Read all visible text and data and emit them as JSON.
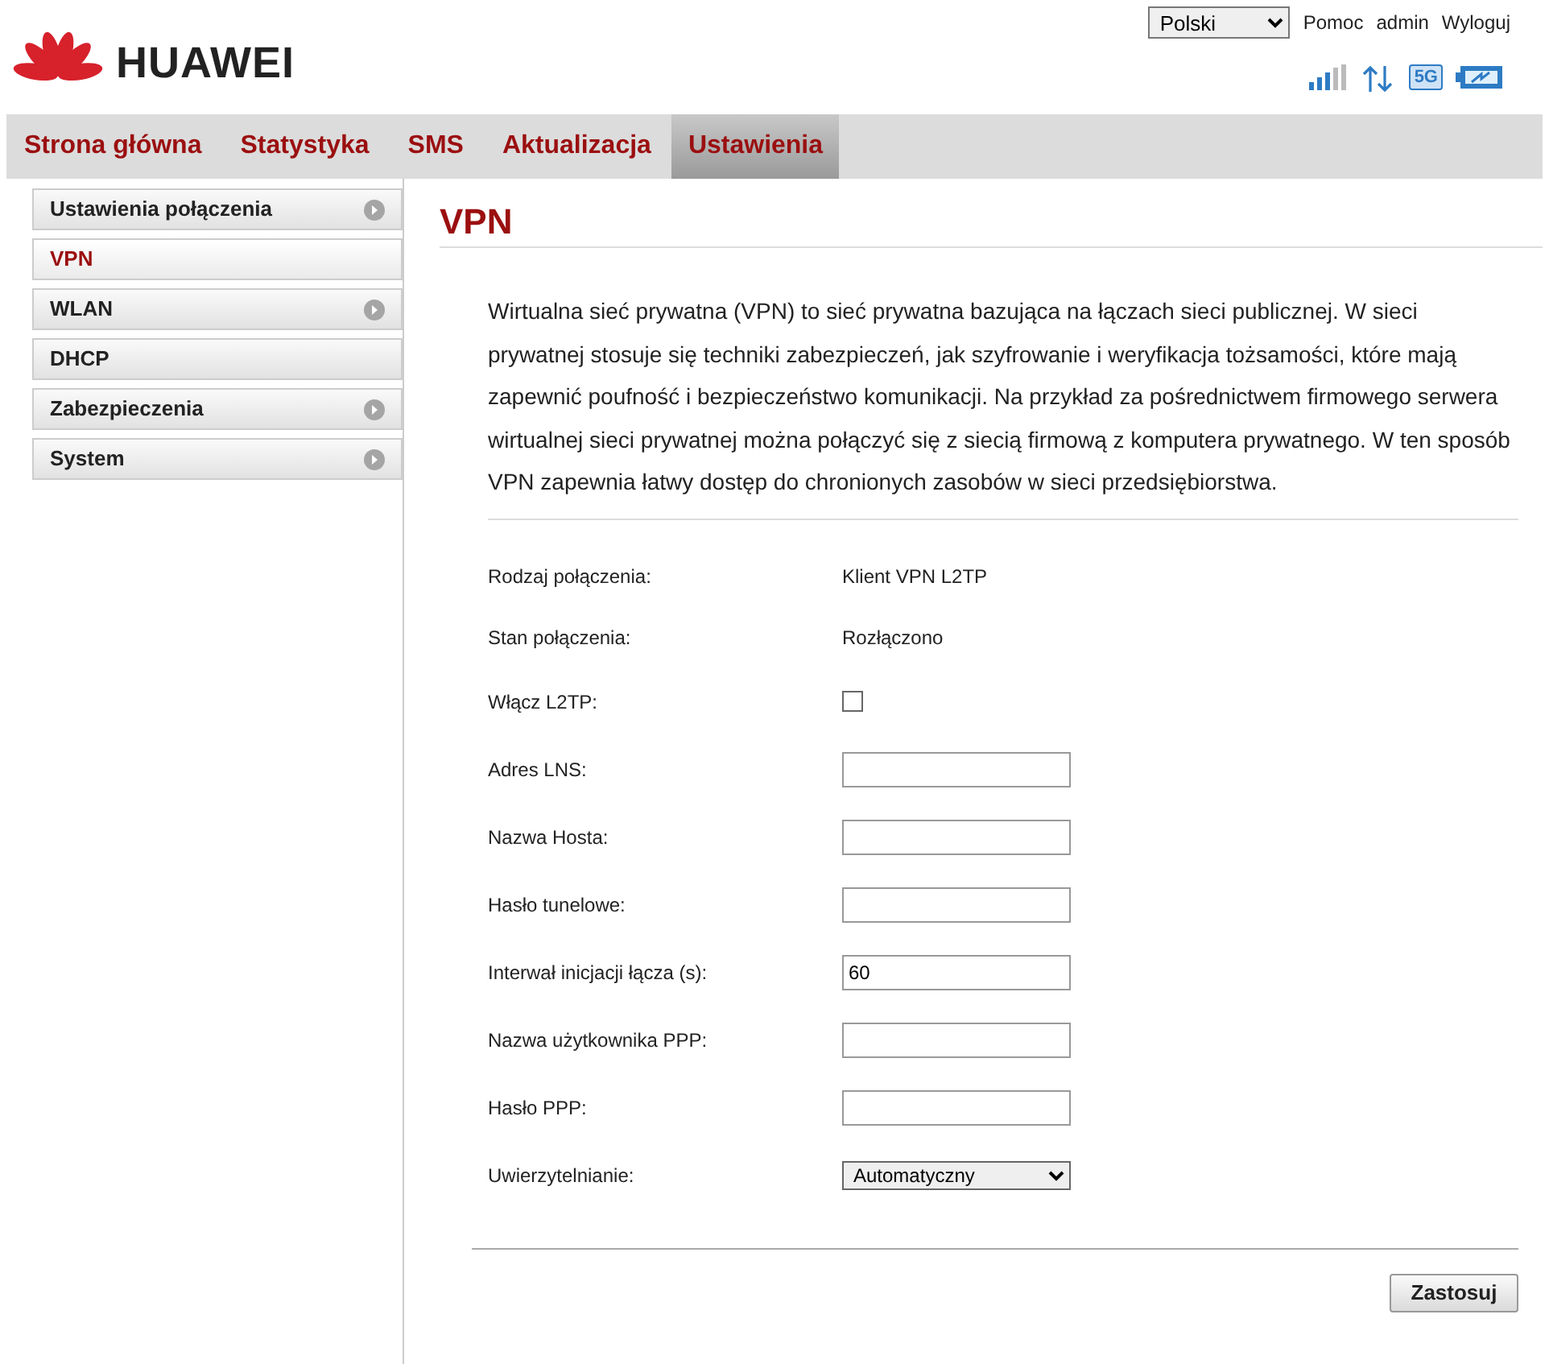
{
  "header": {
    "brand": "HUAWEI",
    "language": "Polski",
    "links": [
      "Pomoc",
      "admin",
      "Wyloguj"
    ],
    "network": "5G"
  },
  "nav": [
    {
      "label": "Strona główna",
      "selected": false
    },
    {
      "label": "Statystyka",
      "selected": false
    },
    {
      "label": "SMS",
      "selected": false
    },
    {
      "label": "Aktualizacja",
      "selected": false
    },
    {
      "label": "Ustawienia",
      "selected": true
    }
  ],
  "sidebar": [
    {
      "label": "Ustawienia połączenia",
      "selected": false,
      "expandable": true
    },
    {
      "label": "VPN",
      "selected": true,
      "expandable": false
    },
    {
      "label": "WLAN",
      "selected": false,
      "expandable": true
    },
    {
      "label": "DHCP",
      "selected": false,
      "expandable": false
    },
    {
      "label": "Zabezpieczenia",
      "selected": false,
      "expandable": true
    },
    {
      "label": "System",
      "selected": false,
      "expandable": true
    }
  ],
  "page": {
    "title": "VPN",
    "description": "Wirtualna sieć prywatna (VPN) to sieć prywatna bazująca na łączach sieci publicznej. W sieci prywatnej stosuje się techniki zabezpieczeń, jak szyfrowanie i weryfikacja tożsamości, które mają zapewnić poufność i bezpieczeństwo komunikacji. Na przykład za pośrednictwem firmowego serwera wirtualnej sieci prywatnej można połączyć się z siecią firmową z komputera prywatnego. W ten sposób VPN zapewnia łatwy dostęp do chronionych zasobów w sieci przedsiębiorstwa."
  },
  "form": [
    {
      "kind": "text",
      "label": "Rodzaj połączenia:",
      "value": "Klient VPN L2TP"
    },
    {
      "kind": "text",
      "label": "Stan połączenia:",
      "value": "Rozłączono"
    },
    {
      "kind": "checkbox",
      "label": "Włącz L2TP:",
      "checked": false
    },
    {
      "kind": "input",
      "label": "Adres LNS:"
    },
    {
      "kind": "input",
      "label": "Nazwa Hosta:"
    },
    {
      "kind": "input",
      "label": "Hasło tunelowe:"
    },
    {
      "kind": "input",
      "label": "Interwał inicjacji łącza (s):",
      "value": "60"
    },
    {
      "kind": "input",
      "label": "Nazwa użytkownika PPP:"
    },
    {
      "kind": "input",
      "label": "Hasło PPP:"
    },
    {
      "kind": "select",
      "label": "Uwierzytelnianie:",
      "value": "Automatyczny"
    }
  ],
  "buttons": [
    "Zastosuj"
  ]
}
